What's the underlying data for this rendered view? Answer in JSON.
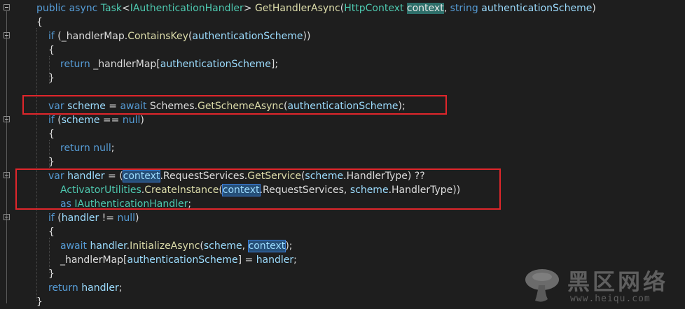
{
  "editor": {
    "lines": [
      {
        "indent": 0,
        "tokens": [
          {
            "t": "public",
            "c": "kw"
          },
          {
            "t": " "
          },
          {
            "t": "async",
            "c": "kw"
          },
          {
            "t": " "
          },
          {
            "t": "Task",
            "c": "ty"
          },
          {
            "t": "<",
            "c": "pl"
          },
          {
            "t": "IAuthenticationHandler",
            "c": "ty"
          },
          {
            "t": "> ",
            "c": "pl"
          },
          {
            "t": "GetHandlerAsync",
            "c": "fn"
          },
          {
            "t": "(",
            "c": "pl"
          },
          {
            "t": "HttpContext",
            "c": "ty"
          },
          {
            "t": " "
          },
          {
            "t": "context",
            "c": "hl-green"
          },
          {
            "t": ", ",
            "c": "pl"
          },
          {
            "t": "string",
            "c": "kw"
          },
          {
            "t": " "
          },
          {
            "t": "authenticationScheme",
            "c": "pa"
          },
          {
            "t": ")",
            "c": "pl"
          }
        ]
      },
      {
        "indent": 0,
        "tokens": [
          {
            "t": "{",
            "c": "pl"
          }
        ]
      },
      {
        "indent": 1,
        "tokens": [
          {
            "t": "if",
            "c": "kw"
          },
          {
            "t": " (_handlerMap.",
            "c": "pl"
          },
          {
            "t": "ContainsKey",
            "c": "fn"
          },
          {
            "t": "(",
            "c": "pl"
          },
          {
            "t": "authenticationScheme",
            "c": "pa"
          },
          {
            "t": "))",
            "c": "pl"
          }
        ]
      },
      {
        "indent": 1,
        "tokens": [
          {
            "t": "{",
            "c": "pl"
          }
        ]
      },
      {
        "indent": 2,
        "tokens": [
          {
            "t": "return",
            "c": "kw"
          },
          {
            "t": " _handlerMap[",
            "c": "pl"
          },
          {
            "t": "authenticationScheme",
            "c": "pa"
          },
          {
            "t": "];",
            "c": "pl"
          }
        ]
      },
      {
        "indent": 1,
        "tokens": [
          {
            "t": "}",
            "c": "pl"
          }
        ]
      },
      {
        "indent": 0,
        "tokens": []
      },
      {
        "indent": 1,
        "tokens": [
          {
            "t": "var",
            "c": "kw"
          },
          {
            "t": " "
          },
          {
            "t": "scheme",
            "c": "pa"
          },
          {
            "t": " = ",
            "c": "pl"
          },
          {
            "t": "await",
            "c": "kw"
          },
          {
            "t": " Schemes.",
            "c": "pl"
          },
          {
            "t": "GetSchemeAsync",
            "c": "fn"
          },
          {
            "t": "(",
            "c": "pl"
          },
          {
            "t": "authenticationScheme",
            "c": "pa"
          },
          {
            "t": ");",
            "c": "pl"
          }
        ]
      },
      {
        "indent": 1,
        "tokens": [
          {
            "t": "if",
            "c": "kw"
          },
          {
            "t": " (",
            "c": "pl"
          },
          {
            "t": "scheme",
            "c": "pa"
          },
          {
            "t": " == ",
            "c": "pl"
          },
          {
            "t": "null",
            "c": "kw"
          },
          {
            "t": ")",
            "c": "pl"
          }
        ]
      },
      {
        "indent": 1,
        "tokens": [
          {
            "t": "{",
            "c": "pl"
          }
        ]
      },
      {
        "indent": 2,
        "tokens": [
          {
            "t": "return",
            "c": "kw"
          },
          {
            "t": " "
          },
          {
            "t": "null",
            "c": "kw"
          },
          {
            "t": ";",
            "c": "pl"
          }
        ]
      },
      {
        "indent": 1,
        "tokens": [
          {
            "t": "}",
            "c": "pl"
          }
        ]
      },
      {
        "indent": 1,
        "tokens": [
          {
            "t": "var",
            "c": "kw"
          },
          {
            "t": " "
          },
          {
            "t": "handler",
            "c": "pa"
          },
          {
            "t": " = (",
            "c": "pl"
          },
          {
            "t": "context",
            "c": "hl"
          },
          {
            "t": ".RequestServices.",
            "c": "pl"
          },
          {
            "t": "GetService",
            "c": "fn"
          },
          {
            "t": "(",
            "c": "pl"
          },
          {
            "t": "scheme",
            "c": "pa"
          },
          {
            "t": ".HandlerType) ??",
            "c": "pl"
          }
        ]
      },
      {
        "indent": 2,
        "tokens": [
          {
            "t": "ActivatorUtilities",
            "c": "ty"
          },
          {
            "t": ".",
            "c": "pl"
          },
          {
            "t": "CreateInstance",
            "c": "fn"
          },
          {
            "t": "(",
            "c": "pl"
          },
          {
            "t": "context",
            "c": "hl"
          },
          {
            "t": ".RequestServices, ",
            "c": "pl"
          },
          {
            "t": "scheme",
            "c": "pa"
          },
          {
            "t": ".HandlerType))",
            "c": "pl"
          }
        ]
      },
      {
        "indent": 2,
        "tokens": [
          {
            "t": "as",
            "c": "kw"
          },
          {
            "t": " "
          },
          {
            "t": "IAuthenticationHandler",
            "c": "ty"
          },
          {
            "t": ";",
            "c": "pl"
          }
        ]
      },
      {
        "indent": 1,
        "tokens": [
          {
            "t": "if",
            "c": "kw"
          },
          {
            "t": " (",
            "c": "pl"
          },
          {
            "t": "handler",
            "c": "pa"
          },
          {
            "t": " != ",
            "c": "pl"
          },
          {
            "t": "null",
            "c": "kw"
          },
          {
            "t": ")",
            "c": "pl"
          }
        ]
      },
      {
        "indent": 1,
        "tokens": [
          {
            "t": "{",
            "c": "pl"
          }
        ]
      },
      {
        "indent": 2,
        "tokens": [
          {
            "t": "await",
            "c": "kw"
          },
          {
            "t": " "
          },
          {
            "t": "handler",
            "c": "pa"
          },
          {
            "t": ".",
            "c": "pl"
          },
          {
            "t": "InitializeAsync",
            "c": "fn"
          },
          {
            "t": "(",
            "c": "pl"
          },
          {
            "t": "scheme",
            "c": "pa"
          },
          {
            "t": ", ",
            "c": "pl"
          },
          {
            "t": "context",
            "c": "hl"
          },
          {
            "t": ");",
            "c": "pl"
          }
        ]
      },
      {
        "indent": 2,
        "tokens": [
          {
            "t": "_handlerMap[",
            "c": "pl"
          },
          {
            "t": "authenticationScheme",
            "c": "pa"
          },
          {
            "t": "] = ",
            "c": "pl"
          },
          {
            "t": "handler",
            "c": "pa"
          },
          {
            "t": ";",
            "c": "pl"
          }
        ]
      },
      {
        "indent": 1,
        "tokens": [
          {
            "t": "}",
            "c": "pl"
          }
        ]
      },
      {
        "indent": 1,
        "tokens": [
          {
            "t": "return",
            "c": "kw"
          },
          {
            "t": " "
          },
          {
            "t": "handler",
            "c": "pa"
          },
          {
            "t": ";",
            "c": "pl"
          }
        ]
      },
      {
        "indent": 0,
        "tokens": [
          {
            "t": "}",
            "c": "pl"
          }
        ]
      }
    ]
  },
  "watermark": {
    "chinese": "黑区网络",
    "url": "www.heiqu.com"
  },
  "colors": {
    "background": "#1e1e1e",
    "keyword": "#569cd6",
    "type": "#4ec9b0",
    "method": "#dcdcaa",
    "identifier": "#9cdcfe",
    "highlight_box": "#e0262b"
  }
}
